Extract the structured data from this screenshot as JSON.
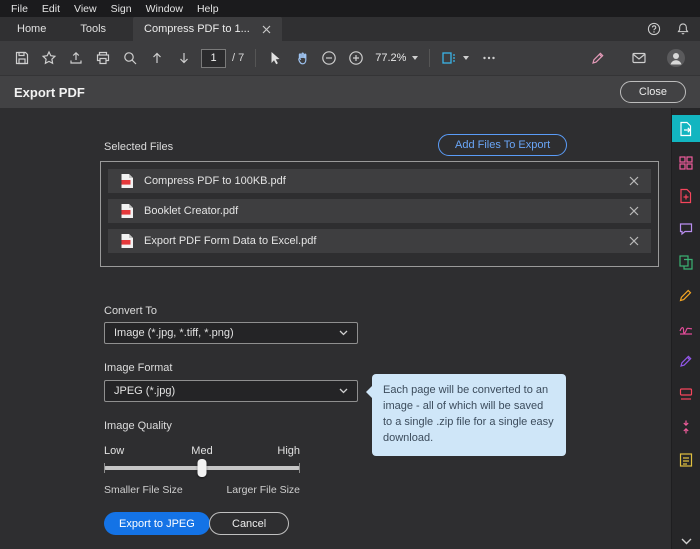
{
  "menubar": {
    "items": [
      "File",
      "Edit",
      "View",
      "Sign",
      "Window",
      "Help"
    ]
  },
  "tabbar": {
    "home": "Home",
    "tools": "Tools",
    "document_tab": "Compress PDF to 1..."
  },
  "toolbar": {
    "page_current": "1",
    "page_total": "/ 7",
    "zoom_level": "77.2%"
  },
  "panel": {
    "title": "Export PDF",
    "close_label": "Close"
  },
  "export": {
    "selected_files_label": "Selected Files",
    "add_files_label": "Add Files To Export",
    "files": [
      {
        "name": "Compress PDF to 100KB.pdf"
      },
      {
        "name": "Booklet Creator.pdf"
      },
      {
        "name": "Export PDF Form Data to Excel.pdf"
      }
    ],
    "convert_to_label": "Convert To",
    "convert_to_value": "Image (*.jpg, *.tiff, *.png)",
    "image_format_label": "Image Format",
    "image_format_value": "JPEG (*.jpg)",
    "tooltip_text": "Each page will be converted to an image - all of which will be saved to a single .zip file for a single easy download.",
    "image_quality_label": "Image Quality",
    "quality": {
      "low": "Low",
      "med": "Med",
      "high": "High",
      "smaller": "Smaller File Size",
      "larger": "Larger File Size"
    },
    "export_button_label": "Export to JPEG",
    "cancel_button_label": "Cancel"
  },
  "colors": {
    "accent_blue": "#1473e6",
    "active_tool_teal": "#12b5c0",
    "tooltip_bg": "#cfe6f8"
  }
}
